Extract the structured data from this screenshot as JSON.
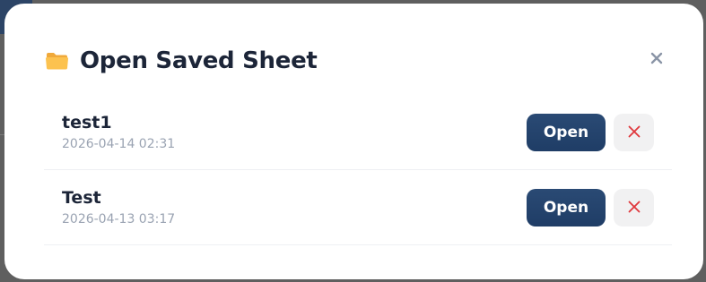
{
  "modal": {
    "title": "Open Saved Sheet",
    "title_icon": "folder-icon",
    "close_icon": "close-icon"
  },
  "saved_sheets": [
    {
      "name": "test1",
      "date": "2026-04-14 02:31",
      "open_label": "Open",
      "delete_icon": "delete-x-icon"
    },
    {
      "name": "Test",
      "date": "2026-04-13 03:17",
      "open_label": "Open",
      "delete_icon": "delete-x-icon"
    }
  ],
  "colors": {
    "primary_button": "#1f3d66",
    "delete_icon": "#e0373c",
    "title_text": "#1c2538",
    "muted_text": "#9aa3b2"
  }
}
